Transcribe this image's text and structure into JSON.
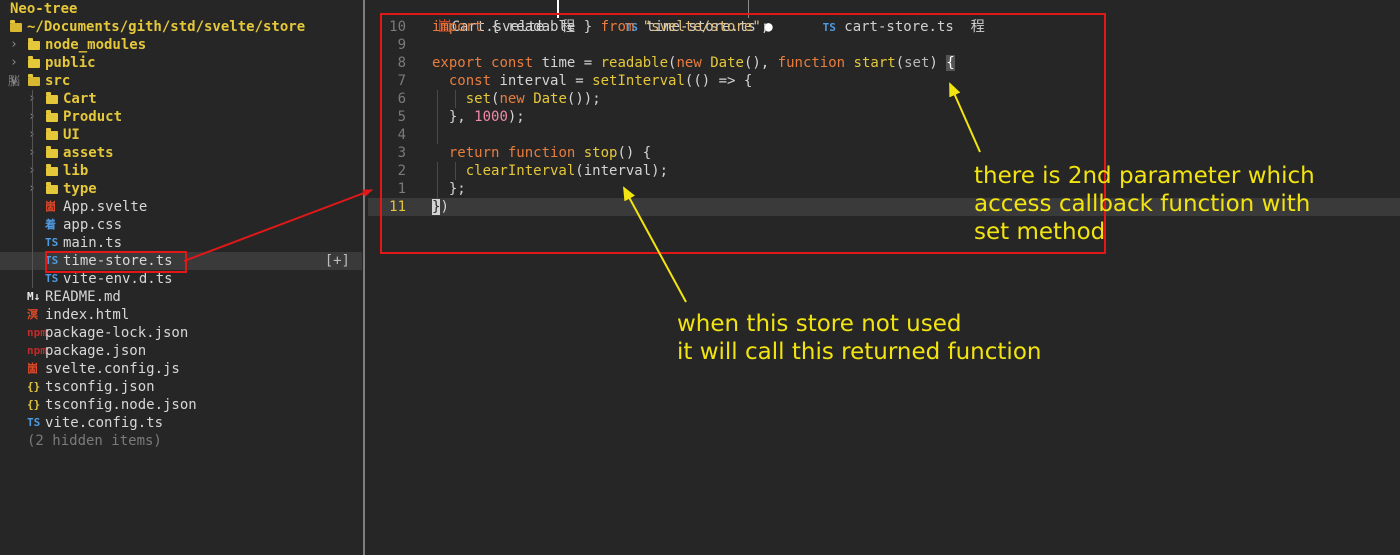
{
  "tree": {
    "title": "Neo-tree",
    "root_path": "~/Documents/gith/std/svelte/store",
    "items": [
      {
        "name": "node_modules",
        "kind": "folder",
        "depth": 0,
        "expanded": false
      },
      {
        "name": "public",
        "kind": "folder",
        "depth": 0,
        "expanded": false
      },
      {
        "name": "src",
        "kind": "folder",
        "depth": 0,
        "expanded": true,
        "gutter": "脳"
      },
      {
        "name": "Cart",
        "kind": "folder",
        "depth": 1,
        "expanded": false
      },
      {
        "name": "Product",
        "kind": "folder",
        "depth": 1,
        "expanded": false
      },
      {
        "name": "UI",
        "kind": "folder",
        "depth": 1,
        "expanded": false
      },
      {
        "name": "assets",
        "kind": "folder",
        "depth": 1,
        "expanded": false
      },
      {
        "name": "lib",
        "kind": "folder",
        "depth": 1,
        "expanded": false
      },
      {
        "name": "type",
        "kind": "folder",
        "depth": 1,
        "expanded": false
      },
      {
        "name": "App.svelte",
        "kind": "svelte",
        "depth": 1,
        "icon": "崮",
        "icon_color": "#e04a2a"
      },
      {
        "name": "app.css",
        "kind": "css",
        "depth": 1,
        "icon": "着",
        "icon_color": "#4f9be0"
      },
      {
        "name": "main.ts",
        "kind": "ts",
        "depth": 1,
        "icon": "TS",
        "icon_color": "#4f9be0"
      },
      {
        "name": "time-store.ts",
        "kind": "ts",
        "depth": 1,
        "icon": "TS",
        "icon_color": "#4f9be0",
        "selected": true,
        "modified": "[+]"
      },
      {
        "name": "vite-env.d.ts",
        "kind": "ts",
        "depth": 1,
        "icon": "TS",
        "icon_color": "#4f9be0"
      },
      {
        "name": "README.md",
        "kind": "md",
        "depth": 0,
        "icon": "M↓",
        "icon_color": "#e8e8e8"
      },
      {
        "name": "index.html",
        "kind": "html",
        "depth": 0,
        "icon": "溟",
        "icon_color": "#e04a2a"
      },
      {
        "name": "package-lock.json",
        "kind": "npm",
        "depth": 0,
        "icon": "npm",
        "icon_color": "#c22a2a"
      },
      {
        "name": "package.json",
        "kind": "npm",
        "depth": 0,
        "icon": "npm",
        "icon_color": "#c22a2a"
      },
      {
        "name": "svelte.config.js",
        "kind": "svelte",
        "depth": 0,
        "icon": "崮",
        "icon_color": "#e04a2a"
      },
      {
        "name": "tsconfig.json",
        "kind": "json",
        "depth": 0,
        "icon": "{}",
        "icon_color": "#e5c83a"
      },
      {
        "name": "tsconfig.node.json",
        "kind": "json",
        "depth": 0,
        "icon": "{}",
        "icon_color": "#e5c83a"
      },
      {
        "name": "vite.config.ts",
        "kind": "ts",
        "depth": 0,
        "icon": "TS",
        "icon_color": "#4f9be0"
      },
      {
        "name": "(2 hidden items)",
        "kind": "hidden",
        "depth": 0
      }
    ]
  },
  "tabs": [
    {
      "icon": "崮",
      "label": "Cart.svelte",
      "suffix": "程"
    },
    {
      "icon": "TS",
      "label": "time-store.ts",
      "suffix": "●",
      "active": true
    },
    {
      "icon": "TS",
      "label": "cart-store.ts",
      "suffix": "程"
    }
  ],
  "editor": {
    "lines": [
      {
        "num": "10",
        "html": "<span class=\"kw\">import</span> { readable } <span class=\"kw\">from</span> <span class=\"str\">\"svelte/store\"</span>;"
      },
      {
        "num": "9",
        "html": ""
      },
      {
        "num": "8",
        "html": "<span class=\"kw\">export</span> <span class=\"kw\">const</span> time = <span class=\"fn\">readable</span>(<span class=\"kw\">new</span> <span class=\"ty\">Date</span>(), <span class=\"kw\">function</span> <span class=\"fn\">start</span>(<span class=\"pm\">set</span>) <span class=\"bm\">{</span>"
      },
      {
        "num": "7",
        "html": "  <span class=\"kw\">const</span> interval = <span class=\"fn\">setInterval</span>(() => {"
      },
      {
        "num": "6",
        "html": "    <span class=\"fn\">set</span>(<span class=\"kw\">new</span> <span class=\"ty\">Date</span>());"
      },
      {
        "num": "5",
        "html": "  }, <span class=\"num\">1000</span>);"
      },
      {
        "num": "4",
        "html": ""
      },
      {
        "num": "3",
        "html": "  <span class=\"kw\">return</span> <span class=\"kw\">function</span> <span class=\"fn\">stop</span>() {"
      },
      {
        "num": "2",
        "html": "    <span class=\"fn\">clearInterval</span>(interval);"
      },
      {
        "num": "1",
        "html": "  };"
      },
      {
        "num": "11",
        "html": "<span class=\"cursor\">}</span>)",
        "current": true
      }
    ]
  },
  "annotations": {
    "note_set": "there is 2nd parameter which\naccess callback function with\nset method",
    "note_stop": "when this store not used\nit will call this returned function",
    "color": "#f2e410",
    "box_color": "#e01818"
  }
}
